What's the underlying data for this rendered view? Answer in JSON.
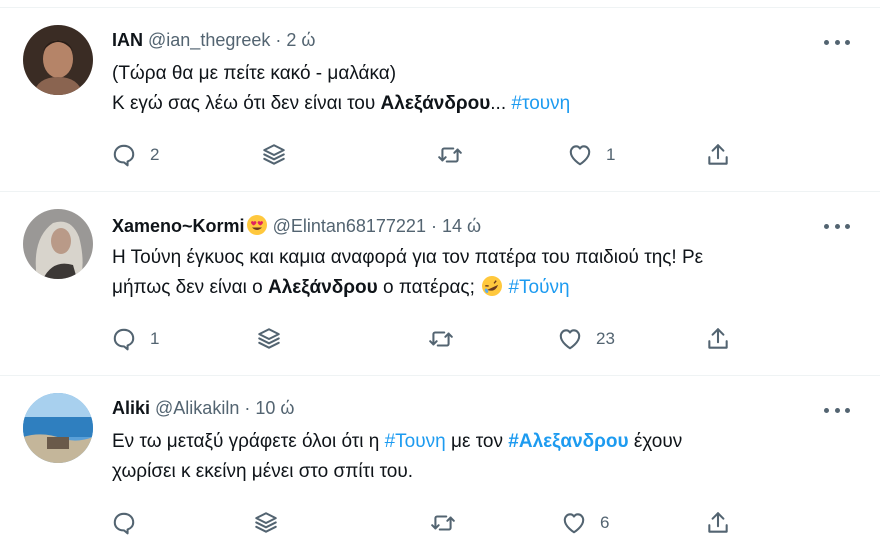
{
  "tweets": [
    {
      "name": "IAN",
      "handle": "@ian_thegreek",
      "dot": "·",
      "time": "2 ώ",
      "line1": "(Τώρα θα με πείτε κακό - μαλάκα)",
      "line2_a": "Κ εγώ σας λέω ότι δεν είναι του ",
      "line2_bold": "Αλεξάνδρου",
      "line2_b": "... ",
      "line2_tag": "#τουνη",
      "replies": "2",
      "likes": "1"
    },
    {
      "name": "Xameno~Kormi",
      "name_emoji": "heart-eyes-emoji",
      "handle": "@Elintan68177221",
      "dot": "·",
      "time": "14 ώ",
      "line1": "Η Τούνη έγκυος και καμια αναφορά για τον πατέρα του παιδιού της! Ρε",
      "line2_a": "μήπως δεν είναι ο ",
      "line2_bold": "Αλεξάνδρου",
      "line2_b": " ο πατέρας; ",
      "line2_emoji": "rofl-emoji",
      "line2_tag": "#Τούνη",
      "replies": "1",
      "likes": "23"
    },
    {
      "name": "Aliki",
      "handle": "@Alikakiln",
      "dot": "·",
      "time": "10 ώ",
      "line1_a": "Εν τω μεταξύ γράφετε όλοι ότι η ",
      "line1_tag": "#Τουνη",
      "line1_b": " με τον ",
      "line1_tag2": "#Αλεξανδρου",
      "line1_c": " έχουν",
      "line2": "χωρίσει κ εκείνη μένει στο σπίτι του.",
      "replies": "",
      "likes": "6"
    }
  ],
  "icons": {
    "reply": "reply-icon",
    "stack": "stack-icon",
    "retweet": "retweet-icon",
    "like": "heart-icon",
    "share": "share-icon",
    "more": "more-icon"
  },
  "colors": {
    "link": "#1d9bf0",
    "secondary": "#536471",
    "text": "#0f1419",
    "divider": "#eff3f4"
  }
}
